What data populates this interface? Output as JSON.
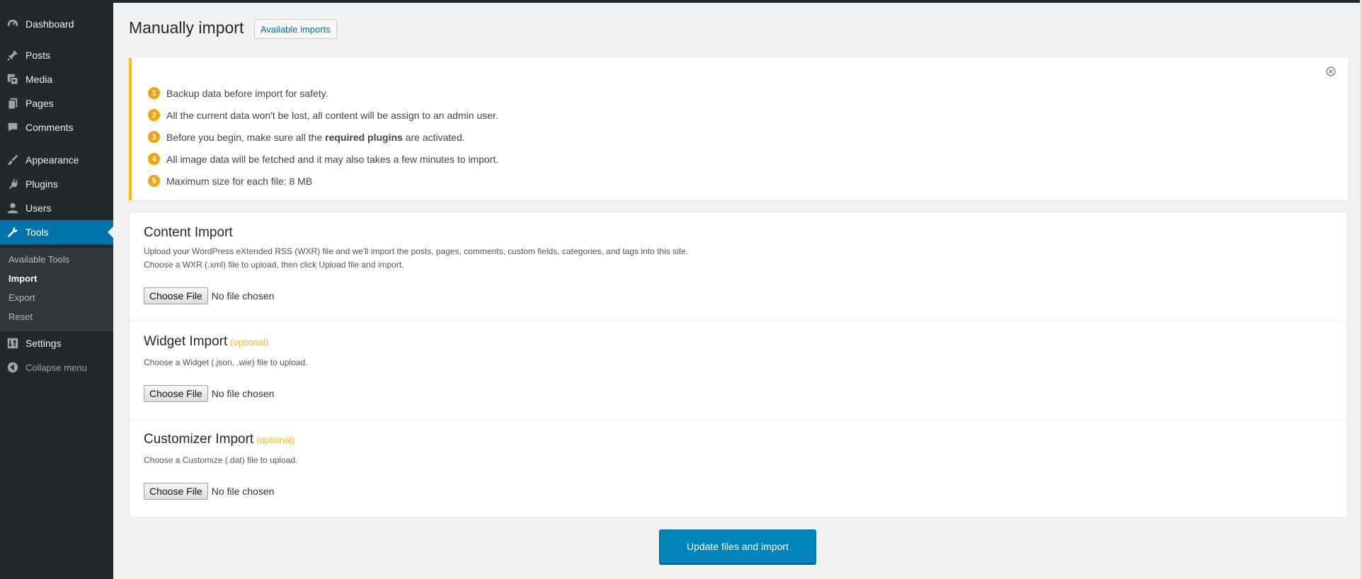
{
  "sidebar": {
    "items": [
      {
        "label": "Dashboard",
        "icon": "dashboard-icon"
      },
      {
        "label": "Posts",
        "icon": "pin-icon"
      },
      {
        "label": "Media",
        "icon": "media-icon"
      },
      {
        "label": "Pages",
        "icon": "pages-icon"
      },
      {
        "label": "Comments",
        "icon": "comment-icon"
      },
      {
        "label": "Appearance",
        "icon": "brush-icon"
      },
      {
        "label": "Plugins",
        "icon": "plug-icon"
      },
      {
        "label": "Users",
        "icon": "user-icon"
      },
      {
        "label": "Tools",
        "icon": "wrench-icon"
      },
      {
        "label": "Settings",
        "icon": "settings-icon"
      }
    ],
    "submenu": [
      "Available Tools",
      "Import",
      "Export",
      "Reset"
    ],
    "collapse_label": "Collapse menu"
  },
  "header": {
    "title": "Manually import",
    "action_label": "Available imports"
  },
  "notice": {
    "items": [
      {
        "num": "1",
        "text": "Backup data before import for safety."
      },
      {
        "num": "2",
        "text": "All the current data won't be lost, all content will be assign to an admin user."
      },
      {
        "num": "3",
        "text_before": "Before you begin, make sure all the ",
        "text_bold": "required plugins",
        "text_after": " are activated."
      },
      {
        "num": "4",
        "text": "All image data will be fetched and it may also takes a few minutes to import."
      },
      {
        "num": "5",
        "text": "Maximum size for each file: 8 MB"
      }
    ]
  },
  "sections": {
    "content": {
      "title": "Content Import",
      "desc1": "Upload your WordPress eXtended RSS (WXR) file and we'll import the posts, pages, comments, custom fields, categories, and tags into this site.",
      "desc2": "Choose a WXR (.xml) file to upload, then click Upload file and import.",
      "button": "Choose File",
      "status": "No file chosen"
    },
    "widget": {
      "title": "Widget Import",
      "optional": "(optional)",
      "desc1": "Choose a Widget (.json, .wie) file to upload.",
      "button": "Choose File",
      "status": "No file chosen"
    },
    "customizer": {
      "title": "Customizer Import",
      "optional": "(optional)",
      "desc1": "Choose a Customize (.dat) file to upload.",
      "button": "Choose File",
      "status": "No file chosen"
    }
  },
  "submit_label": "Update files and import",
  "colors": {
    "sidebar_bg": "#23282d",
    "active": "#0073aa",
    "notice_accent": "#ffb900",
    "number_badge": "#f0a30a",
    "primary_button": "#0085ba"
  }
}
